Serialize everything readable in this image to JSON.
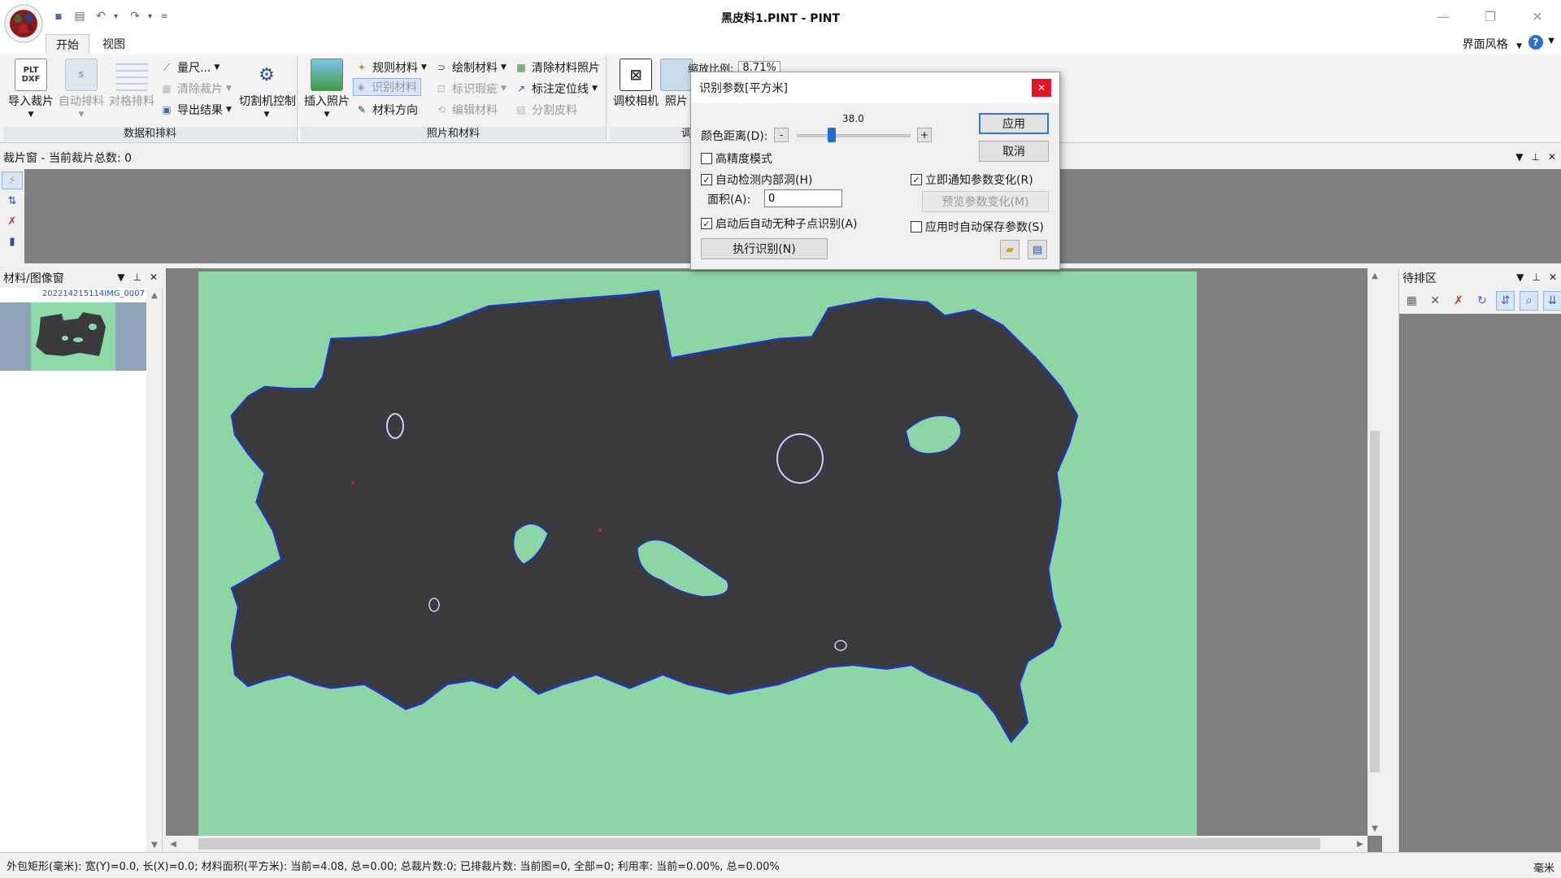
{
  "title": "黑皮料1.PINT - PINT",
  "tabs": [
    {
      "label": "开始"
    },
    {
      "label": "视图"
    }
  ],
  "style_menu": "界面风格",
  "groups": {
    "data_nesting": {
      "label": "数据和排料",
      "import_pieces": "导入裁片",
      "auto_nest": "自动排料",
      "grid_nest": "对格排料",
      "measure": "量尺...",
      "clear_pieces": "清除裁片",
      "export_result": "导出结果",
      "cutter_control": "切割机控制"
    },
    "photo_material": {
      "label": "照片和材料",
      "insert_photo": "插入照片",
      "regular_material": "规则材料",
      "recognize_material": "识别材料",
      "material_direction": "材料方向",
      "draw_material": "绘制材料",
      "mark_defect": "标识瑕疵",
      "edit_material": "编辑材料",
      "clear_photo": "清除材料照片",
      "mark_locator": "标注定位线",
      "split_leather": "分割皮料"
    },
    "calibrate": {
      "label": "调",
      "calibrate_camera": "调校相机",
      "photo": "照片",
      "zoom_label": "缩放比例:",
      "zoom_value": "8.71%"
    }
  },
  "pieces_pane": {
    "title": "裁片窗 - 当前裁片总数: 0"
  },
  "material_pane": {
    "title": "材料/图像窗",
    "item_name": "202214215114IMG_0007"
  },
  "queue_pane": {
    "title": "待排区"
  },
  "status": {
    "text": "外包矩形(毫米): 宽(Y)=0.0, 长(X)=0.0; 材料面积(平方米): 当前=4.08, 总=0.00; 总裁片数:0; 已排裁片数: 当前图=0, 全部=0; 利用率: 当前=0.00%, 总=0.00%",
    "unit": "毫米"
  },
  "dialog": {
    "title": "识别参数[平方米]",
    "color_distance_label": "颜色距离(D):",
    "color_distance_value": "38.0",
    "color_distance_fraction": 0.31,
    "minus": "-",
    "plus": "+",
    "apply": "应用",
    "cancel": "取消",
    "high_precision": {
      "label": "高精度模式",
      "checked": false
    },
    "auto_holes": {
      "label": "自动检测内部洞(H)",
      "checked": true
    },
    "area_label": "面积(A):",
    "area_value": "0",
    "auto_seedless": {
      "label": "启动后自动无种子点识别(A)",
      "checked": true
    },
    "notify_change": {
      "label": "立即通知参数变化(R)",
      "checked": true
    },
    "preview_change": "预览参数变化(M)",
    "auto_save": {
      "label": "应用时自动保存参数(S)",
      "checked": false
    },
    "execute": "执行识别(N)"
  },
  "colors": {
    "board": "#8cd6a4",
    "leather": "#3a3a3d",
    "outline": "#2233cc",
    "accent": "#1f6fd1"
  }
}
